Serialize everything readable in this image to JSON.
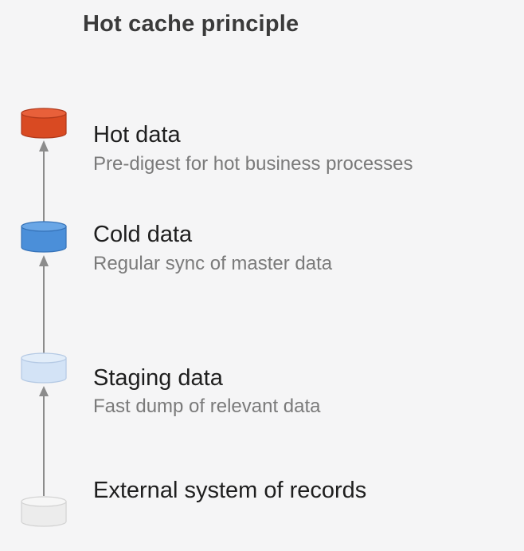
{
  "title": "Hot cache principle",
  "layers": [
    {
      "label": "Hot data",
      "description": "Pre-digest for hot business processes",
      "icon": "database-icon",
      "color": "#d94a22"
    },
    {
      "label": "Cold data",
      "description": "Regular sync of master data",
      "icon": "database-icon",
      "color": "#4b8fd9"
    },
    {
      "label": "Staging data",
      "description": "Fast dump of relevant data",
      "icon": "database-icon",
      "color": "#d3e3f6"
    },
    {
      "label": "External system of records",
      "description": "",
      "icon": "database-icon",
      "color": "#ececec"
    }
  ],
  "connector_color": "#8c8c8c"
}
